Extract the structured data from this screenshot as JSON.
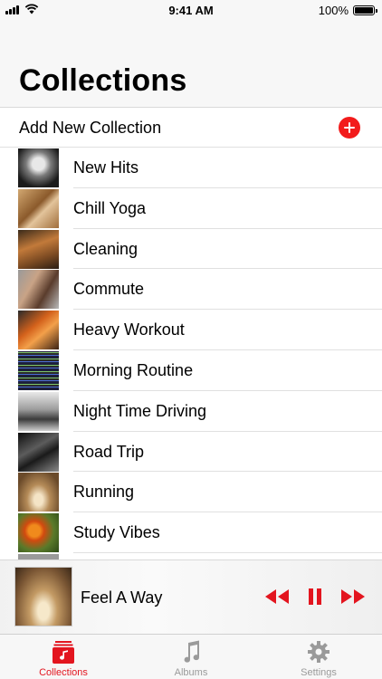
{
  "status_bar": {
    "time": "9:41 AM",
    "battery": "100%"
  },
  "header": {
    "title": "Collections"
  },
  "add_row": {
    "label": "Add New Collection"
  },
  "collections": [
    {
      "label": "New Hits"
    },
    {
      "label": "Chill Yoga"
    },
    {
      "label": "Cleaning"
    },
    {
      "label": "Commute"
    },
    {
      "label": "Heavy Workout"
    },
    {
      "label": "Morning Routine"
    },
    {
      "label": "Night Time Driving"
    },
    {
      "label": "Road Trip"
    },
    {
      "label": "Running"
    },
    {
      "label": "Study Vibes"
    }
  ],
  "now_playing": {
    "title": "Feel A Way"
  },
  "tab_bar": {
    "tabs": [
      {
        "label": "Collections",
        "icon": "collections-icon",
        "active": true
      },
      {
        "label": "Albums",
        "icon": "music-note-icon",
        "active": false
      },
      {
        "label": "Settings",
        "icon": "gear-icon",
        "active": false
      }
    ]
  },
  "colors": {
    "accent": "#e3151f",
    "add_button": "#f21b1b",
    "inactive_tab": "#9a9a9a"
  }
}
